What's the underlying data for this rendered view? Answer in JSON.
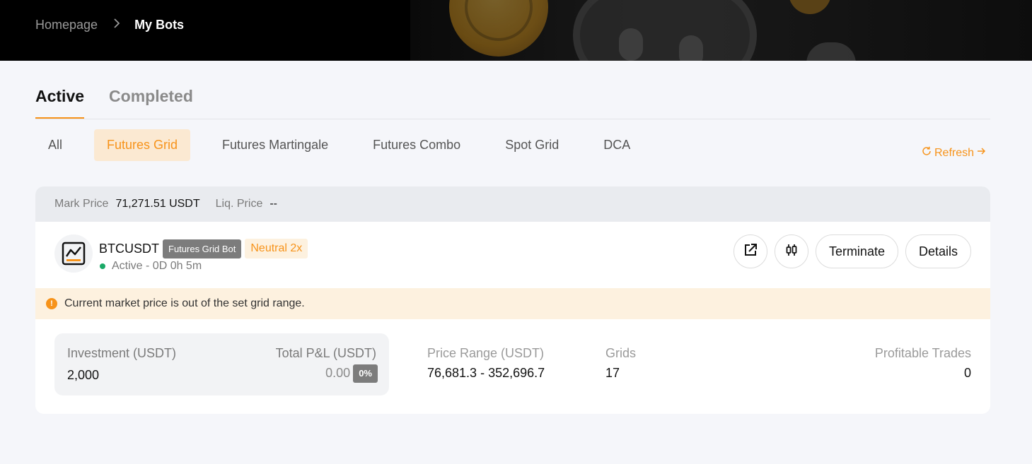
{
  "breadcrumb": {
    "home": "Homepage",
    "current": "My Bots"
  },
  "main_tabs": [
    {
      "label": "Active",
      "active": true
    },
    {
      "label": "Completed",
      "active": false
    }
  ],
  "sub_tabs": [
    {
      "label": "All",
      "active": false
    },
    {
      "label": "Futures Grid",
      "active": true
    },
    {
      "label": "Futures Martingale",
      "active": false
    },
    {
      "label": "Futures Combo",
      "active": false
    },
    {
      "label": "Spot Grid",
      "active": false
    },
    {
      "label": "DCA",
      "active": false
    }
  ],
  "refresh_label": "Refresh",
  "card": {
    "mark_price_label": "Mark Price",
    "mark_price_value": "71,271.51 USDT",
    "liq_price_label": "Liq. Price",
    "liq_price_value": "--",
    "pair": "BTCUSDT",
    "bot_type": "Futures Grid Bot",
    "mode": "Neutral 2x",
    "status": "Active - 0D 0h 5m",
    "actions": {
      "terminate": "Terminate",
      "details": "Details"
    },
    "warning": "Current market price is out of the set grid range.",
    "investment_label": "Investment (USDT)",
    "investment_value": "2,000",
    "pnl_label": "Total P&L (USDT)",
    "pnl_value": "0.00",
    "pnl_pct": "0%",
    "price_range_label": "Price Range (USDT)",
    "price_range_value": "76,681.3 - 352,696.7",
    "grids_label": "Grids",
    "grids_value": "17",
    "profitable_trades_label": "Profitable Trades",
    "profitable_trades_value": "0"
  },
  "colors": {
    "accent": "#f7931a",
    "status_active": "#1aa967",
    "header_bg": "#000000"
  },
  "icons": [
    "chevron-right-icon",
    "refresh-icon",
    "arrow-right-icon",
    "chart-icon",
    "share-icon",
    "candlestick-icon",
    "warning-icon"
  ]
}
